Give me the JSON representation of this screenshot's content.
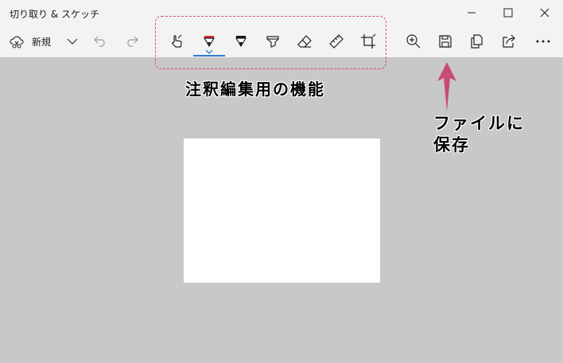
{
  "window": {
    "title": "切り取り & スケッチ",
    "controls": [
      "minimize",
      "maximize",
      "close"
    ]
  },
  "toolbar": {
    "new_label": "新規",
    "left_icons": [
      "snip-icon",
      "chevron-down-icon",
      "undo-icon",
      "redo-icon"
    ],
    "annotation_tools": [
      "touch-writing-icon",
      "ballpoint-pen-icon",
      "pencil-icon",
      "highlighter-icon",
      "eraser-icon",
      "ruler-icon",
      "crop-icon"
    ],
    "selected_tool": "ballpoint-pen",
    "right_icons": [
      "zoom-in-icon",
      "save-icon",
      "copy-icon",
      "share-icon",
      "more-icon"
    ]
  },
  "annotations": {
    "tools_group": "注釈編集用の機能",
    "save_line1": "ファイルに",
    "save_line2": "保存"
  },
  "colors": {
    "accent_blue": "#2d7ad6",
    "annotation_pink": "#d64b82",
    "pen_red": "#e0232c",
    "background": "#c8c8c8"
  }
}
